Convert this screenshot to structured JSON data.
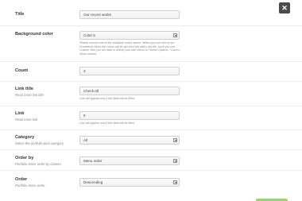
{
  "dialog": {
    "close_icon": "close-icon",
    "close_glyph": "✕"
  },
  "title": {
    "label": "Title",
    "value": "Our recent works"
  },
  "background_color": {
    "label": "Background color",
    "value": "Color 5",
    "help": "Please choose one of the available colors above. When you use one of our Predefined Skins the colors will be get from the skin's css file, but if you use Custom Skin you are able to define your own colors in Theme Options › Colors › Skins section."
  },
  "count": {
    "label": "Count",
    "value": "3"
  },
  "link_title": {
    "label": "Link title",
    "sublabel": "Read more link title",
    "value": "Check all",
    "help": "Link will appear only if this field will be filled."
  },
  "link": {
    "label": "Link",
    "sublabel": "Read more link",
    "value": "#",
    "help": "Link will appear only if this field will be filled."
  },
  "category": {
    "label": "Category",
    "sublabel": "Select the portfolio post category",
    "value": "All"
  },
  "order_by": {
    "label": "Order by",
    "sublabel": "Portfolio items order by column.",
    "value": "Menu order"
  },
  "order": {
    "label": "Order",
    "sublabel": "Portfolio items order",
    "value": "Descending"
  },
  "colors": {
    "close_bg": "#4a4a4a",
    "save_button": "#9bd17a"
  }
}
